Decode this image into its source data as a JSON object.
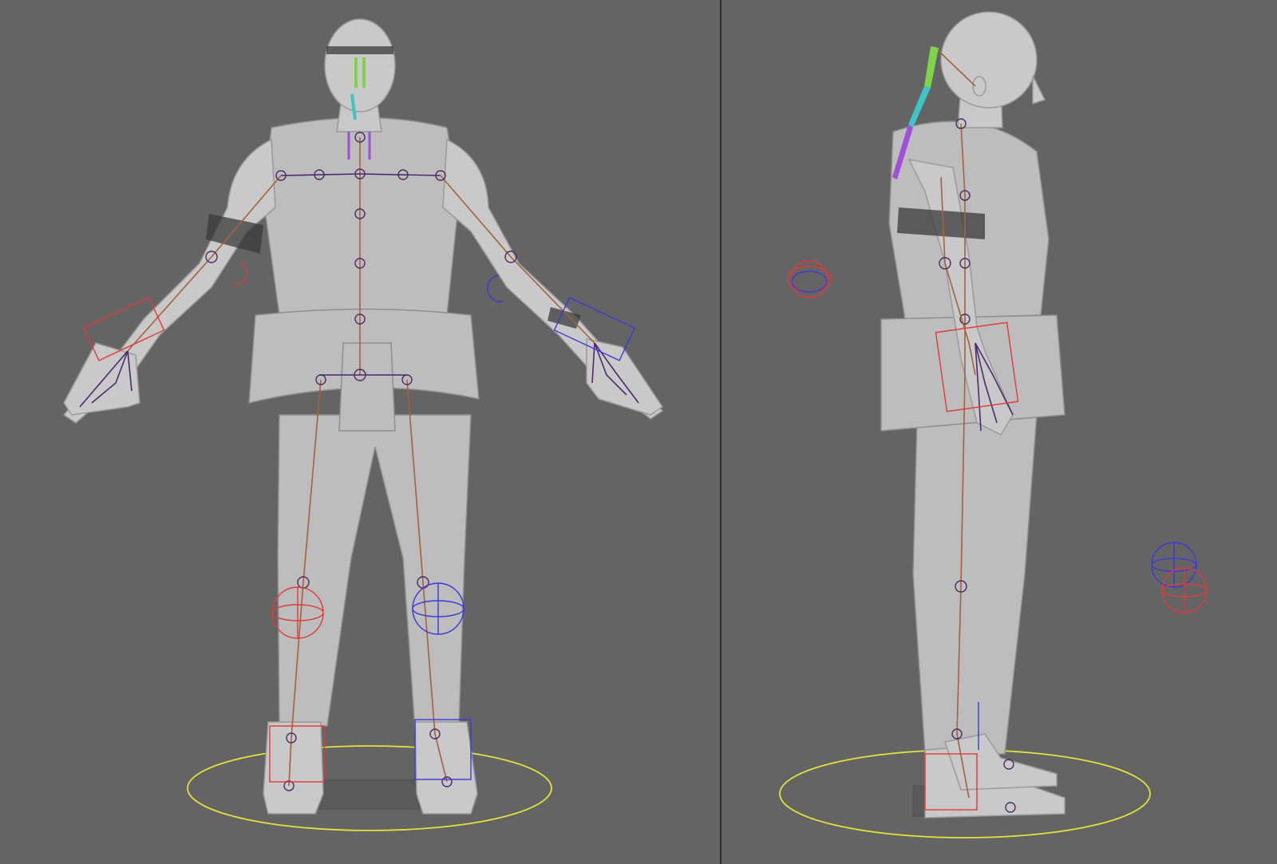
{
  "scene": {
    "viewports": [
      {
        "name": "front",
        "view": "front"
      },
      {
        "name": "side",
        "view": "right"
      }
    ],
    "colors": {
      "background": "#646464",
      "mesh": "#c9c9c9",
      "bone": "#a4623e",
      "joint": "#4a2d63",
      "ik_left": "#e03a3a",
      "ik_right": "#3a3ad8",
      "ground_control": "#e2e23a",
      "hair_chain": [
        "#7fd34a",
        "#3fc3c3",
        "#a050d8"
      ]
    },
    "icons": [
      "joint-icon",
      "ik-handle-icon",
      "pole-vector-icon",
      "ground-control-icon"
    ]
  }
}
